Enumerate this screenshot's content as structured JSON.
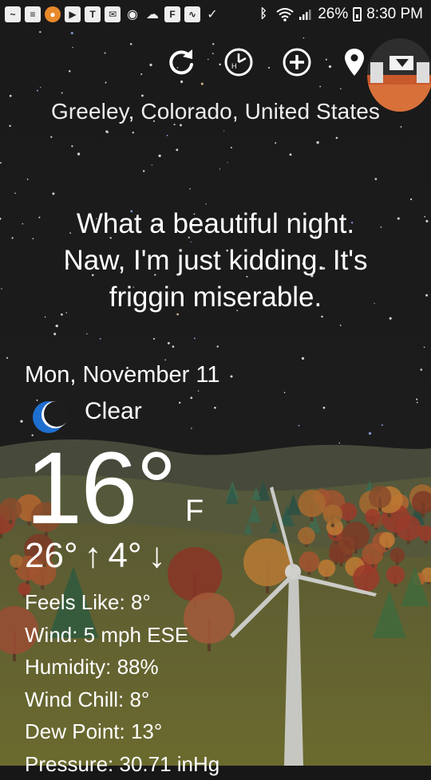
{
  "status_bar": {
    "battery": "26%",
    "time": "8:30 PM"
  },
  "toolbar": {
    "refresh_icon": "refresh-icon",
    "history_icon": "clock-history-icon",
    "add_icon": "add-location-icon",
    "location_icon": "location-pin-icon"
  },
  "location": "Greeley, Colorado, United States",
  "message": {
    "line1": "What a beautiful night.",
    "line2": "Naw, I'm just kidding. It's",
    "line3": "friggin miserable."
  },
  "weather": {
    "date": "Mon, November 11",
    "condition": "Clear",
    "temperature": "16°",
    "unit": "F",
    "high": "26°",
    "low": "4°"
  },
  "details": {
    "feels_like": "Feels Like: 8°",
    "wind": "Wind: 5 mph ESE",
    "humidity": "Humidity: 88%",
    "wind_chill": "Wind Chill: 8°",
    "dew_point": "Dew Point: 13°",
    "pressure": "Pressure: 30.71 inHg"
  },
  "colors": {
    "sky": "#171717",
    "hill_far": "#4b4f3c",
    "hill_near": "#6a6a34",
    "moon": "#1f6fd0"
  }
}
